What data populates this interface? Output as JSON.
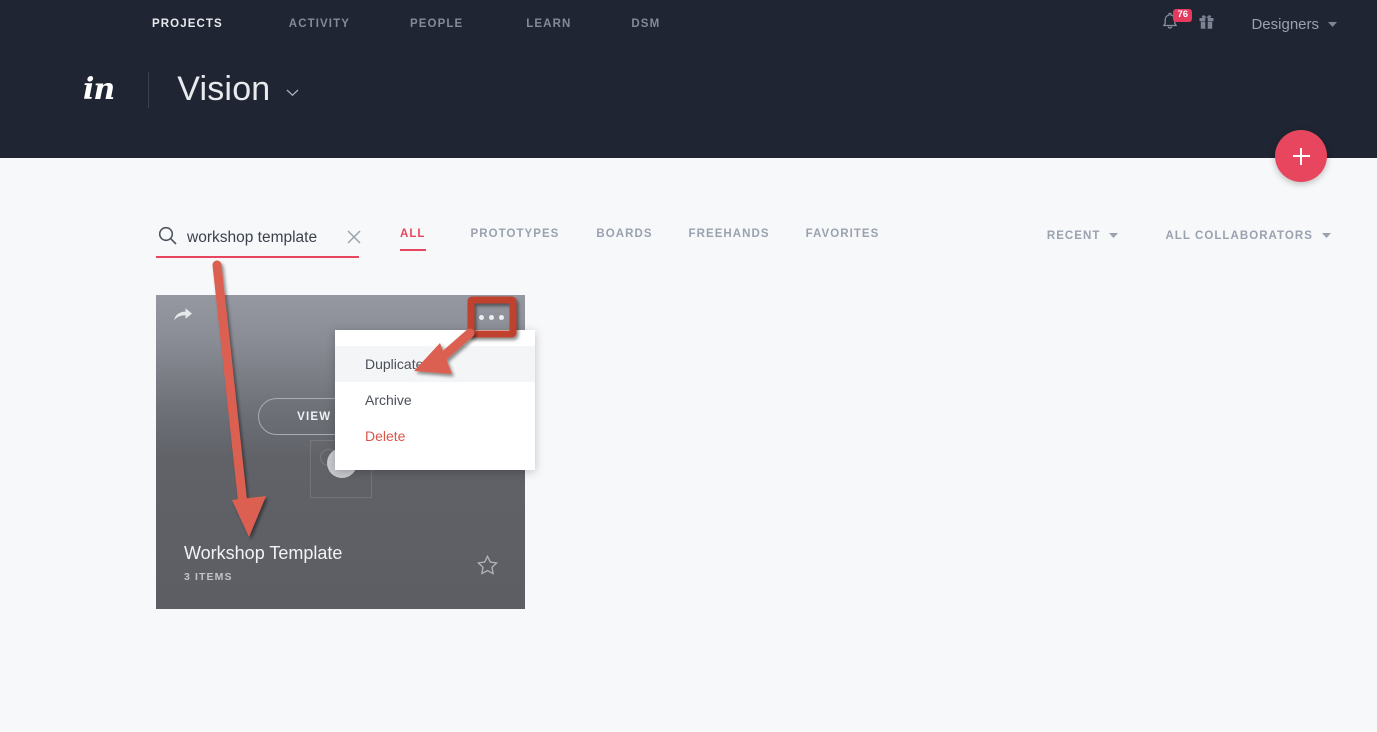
{
  "header": {
    "nav": [
      {
        "label": "PROJECTS",
        "active": true
      },
      {
        "label": "ACTIVITY",
        "active": false
      },
      {
        "label": "PEOPLE",
        "active": false
      },
      {
        "label": "LEARN",
        "active": false
      },
      {
        "label": "DSM",
        "active": false
      }
    ],
    "notification_count": "76",
    "user_name": "Designers",
    "logo_text": "in",
    "project_title": "Vision",
    "bg_color": "#1F2532"
  },
  "fab": {
    "label": "+",
    "color": "#E8465F"
  },
  "search": {
    "value": "workshop template",
    "placeholder": "Search",
    "clear_label": "×"
  },
  "tabs": [
    {
      "label": "ALL",
      "active": true
    },
    {
      "label": "PROTOTYPES",
      "active": false
    },
    {
      "label": "BOARDS",
      "active": false
    },
    {
      "label": "FREEHANDS",
      "active": false
    },
    {
      "label": "FAVORITES",
      "active": false
    }
  ],
  "filters": [
    {
      "label": "RECENT"
    },
    {
      "label": "ALL COLLABORATORS"
    }
  ],
  "card": {
    "title": "Workshop Template",
    "subtitle": "3 ITEMS",
    "view_button": "VIEW BOARD"
  },
  "context_menu": [
    {
      "label": "Duplicate",
      "hover": true,
      "danger": false
    },
    {
      "label": "Archive",
      "hover": false,
      "danger": false
    },
    {
      "label": "Delete",
      "hover": false,
      "danger": true
    }
  ],
  "annotation": {
    "color": "#DB6151",
    "highlight_color": "#C0432F"
  }
}
